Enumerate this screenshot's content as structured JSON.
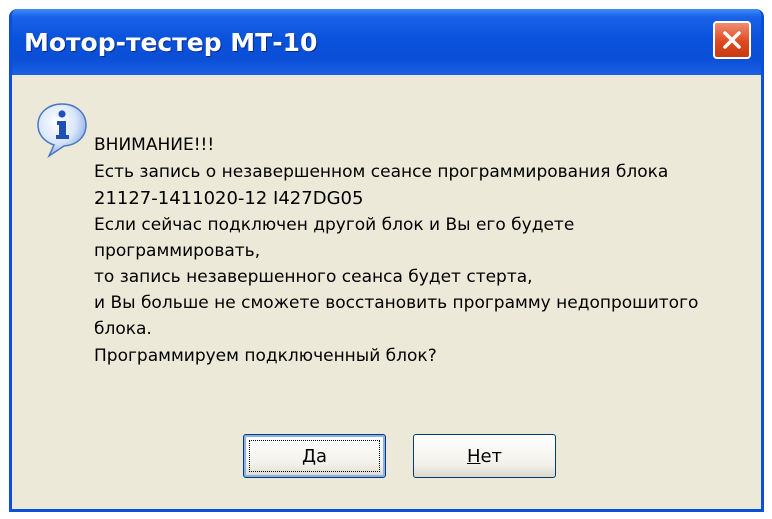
{
  "window": {
    "title": "Мотор-тестер МТ-10",
    "close_icon": "close-icon"
  },
  "dialog": {
    "icon": "info-icon",
    "lines": [
      " ВНИМАНИЕ!!!",
      "Есть запись о незавершенном сеансе программирования блока",
      "21127-1411020-12  I427DG05",
      "Если сейчас подключен другой блок и Вы его будете",
      "программировать,",
      "то запись незавершенного сеанса будет стерта,",
      "и Вы больше не сможете восстановить программу недопрошитого",
      "блока.",
      "  Программируем подключенный блок?"
    ]
  },
  "buttons": {
    "yes": {
      "mnemonic": "Д",
      "rest": "а"
    },
    "no": {
      "mnemonic": "Н",
      "rest": "ет"
    }
  },
  "colors": {
    "titlebar": "#0a52db",
    "dialog_bg": "#ece9d8",
    "close_button": "#df4a20"
  }
}
